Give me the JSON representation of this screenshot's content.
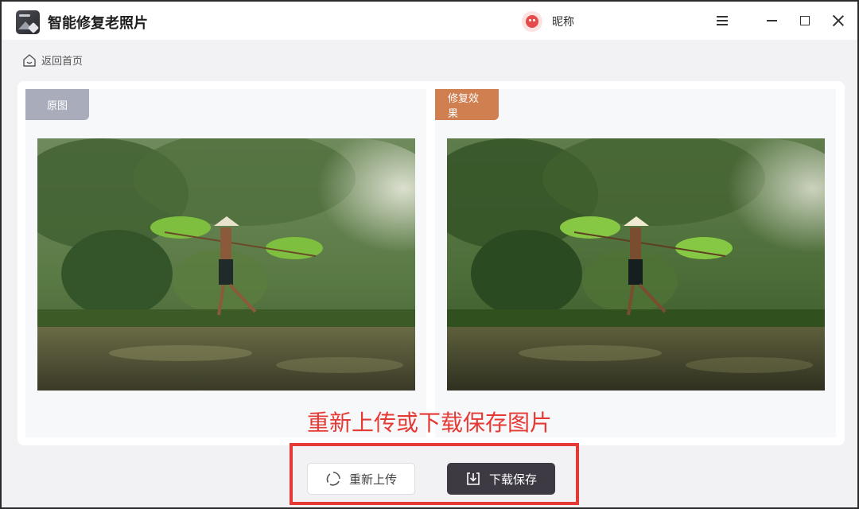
{
  "app": {
    "title": "智能修复老照片",
    "username": "昵称"
  },
  "nav": {
    "back_label": "返回首页"
  },
  "panels": {
    "original_label": "原图",
    "result_label": "修复效果"
  },
  "annotation": "重新上传或下载保存图片",
  "actions": {
    "reupload_label": "重新上传",
    "download_label": "下载保存"
  },
  "colors": {
    "original_tag": "#a9adbb",
    "result_tag": "#cf7f50",
    "download_button": "#3d3a44",
    "annotation": "#e53935"
  },
  "icons": {
    "logo": "photo-restore-logo",
    "avatar": "tomato-avatar",
    "menu": "hamburger-icon",
    "minimize": "minimize-icon",
    "maximize": "maximize-icon",
    "close": "close-icon",
    "back": "home-icon",
    "reupload": "refresh-icon",
    "download": "download-icon"
  }
}
